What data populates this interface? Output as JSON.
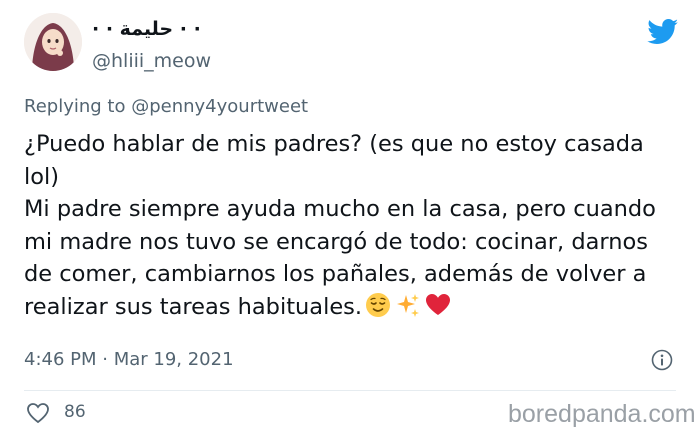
{
  "author": {
    "display_name": "· · حليمة · ·",
    "handle": "@hliii_meow"
  },
  "reply": {
    "prefix": "Replying to ",
    "mention": "@penny4yourtweet"
  },
  "tweet": {
    "line1": "¿Puedo hablar de mis padres? (es que no estoy casada lol)",
    "line2": "Mi padre siempre ayuda mucho en la casa, pero cuando mi madre nos tuvo se encargó de todo: cocinar, darnos de comer, cambiarnos los pañales, además de volver a realizar sus tareas habituales.",
    "emoji_icons": [
      "relieved-face-icon",
      "sparkles-icon",
      "red-heart-icon"
    ]
  },
  "timestamp": "4:46 PM · Mar 19, 2021",
  "likes": "86",
  "watermark": "boredpanda.com",
  "colors": {
    "twitter_blue": "#1d9bf0",
    "secondary_text": "#536471",
    "primary_text": "#0f1419",
    "heart_red": "#e0243b"
  }
}
